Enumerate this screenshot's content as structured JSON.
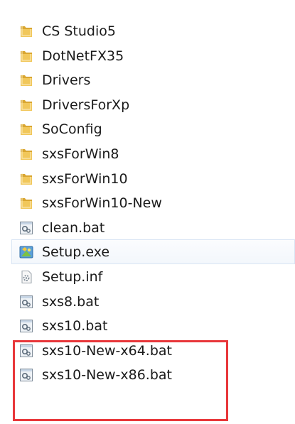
{
  "files": [
    {
      "name": "CS Studio5",
      "icon": "folder-icon"
    },
    {
      "name": "DotNetFX35",
      "icon": "folder-icon"
    },
    {
      "name": "Drivers",
      "icon": "folder-icon"
    },
    {
      "name": "DriversForXp",
      "icon": "folder-icon"
    },
    {
      "name": "SoConfig",
      "icon": "folder-icon"
    },
    {
      "name": "sxsForWin8",
      "icon": "folder-icon"
    },
    {
      "name": "sxsForWin10",
      "icon": "folder-icon"
    },
    {
      "name": "sxsForWin10-New",
      "icon": "folder-icon"
    },
    {
      "name": "clean.bat",
      "icon": "batch-file-icon"
    },
    {
      "name": "Setup.exe",
      "icon": "setup-exe-icon"
    },
    {
      "name": "Setup.inf",
      "icon": "inf-file-icon"
    },
    {
      "name": "sxs8.bat",
      "icon": "batch-file-icon"
    },
    {
      "name": "sxs10.bat",
      "icon": "batch-file-icon"
    },
    {
      "name": "sxs10-New-x64.bat",
      "icon": "batch-file-icon"
    },
    {
      "name": "sxs10-New-x86.bat",
      "icon": "batch-file-icon"
    }
  ],
  "colors": {
    "folder": "#e8b84a",
    "highlight_border": "#e8373a",
    "selection_border": "#d9e5f4"
  }
}
